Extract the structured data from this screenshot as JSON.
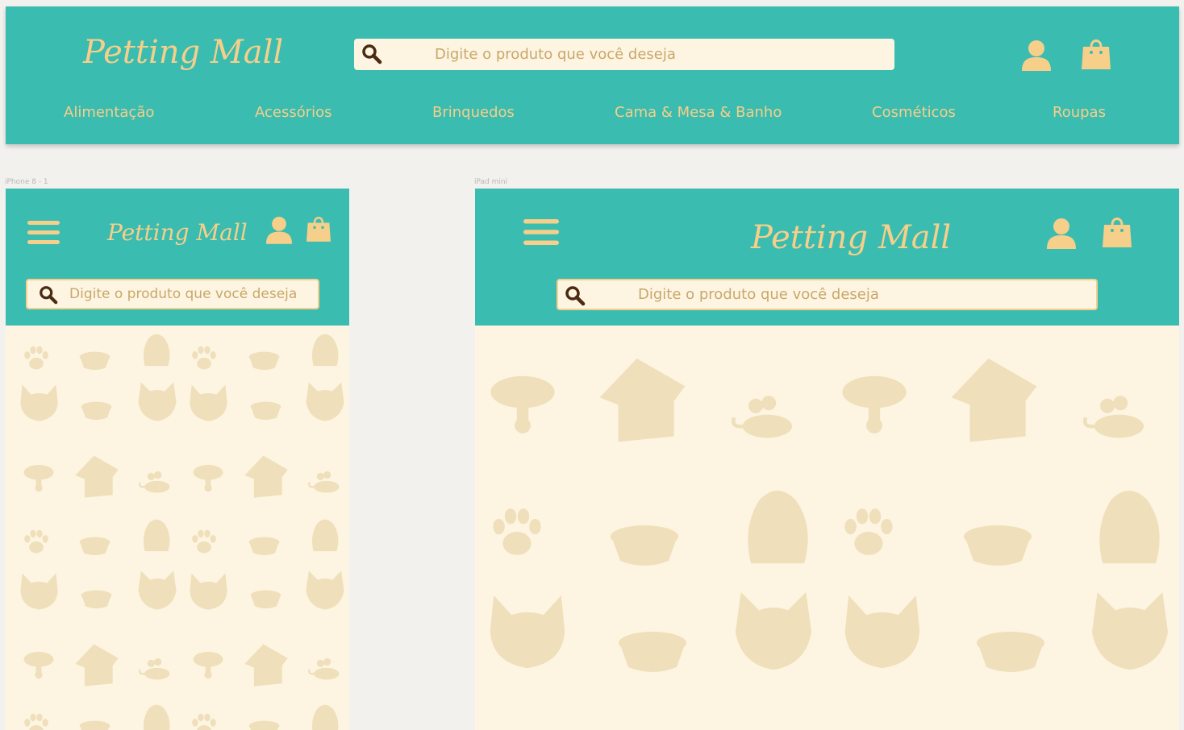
{
  "brand": {
    "logo_text": "Petting Mall"
  },
  "search": {
    "placeholder": "Digite o produto que você deseja"
  },
  "nav": {
    "items": [
      {
        "label": "Alimentação"
      },
      {
        "label": "Acessórios"
      },
      {
        "label": "Brinquedos"
      },
      {
        "label": "Cama & Mesa & Banho"
      },
      {
        "label": "Cosméticos"
      },
      {
        "label": "Roupas"
      }
    ]
  },
  "artboards": {
    "iphone": "iPhone 8 - 1",
    "ipad": "iPad mini"
  },
  "colors": {
    "primary": "#3bbcb0",
    "accent": "#f6cf8a",
    "background": "#fdf5e2",
    "pattern": "#efdfba"
  },
  "icons": {
    "search": "search-icon",
    "user": "user-icon",
    "cart": "shopping-bag-icon",
    "menu": "hamburger-menu-icon"
  }
}
